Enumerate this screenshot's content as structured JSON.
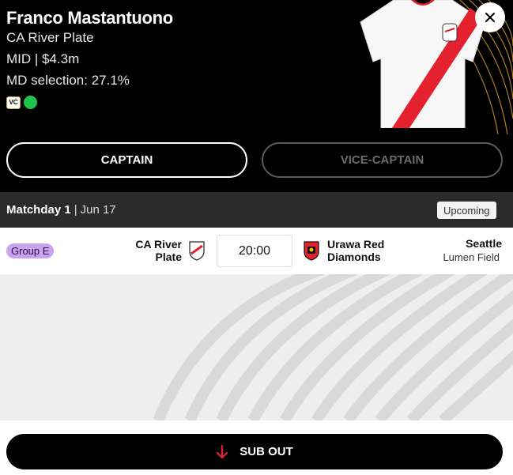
{
  "player": {
    "name": "Franco Mastantuono",
    "club": "CA River Plate",
    "position_price": "MID | $4.3m",
    "selection": "MD selection: 27.1%",
    "vc_badge": "VC"
  },
  "actions": {
    "captain_label": "CAPTAIN",
    "vice_captain_label": "VICE-CAPTAIN",
    "sub_out_label": "SUB OUT"
  },
  "matchday": {
    "title": "Matchday 1",
    "separator": "|",
    "date": "Jun 17",
    "status": "Upcoming"
  },
  "fixture": {
    "group": "Group E",
    "home_team": "CA River Plate",
    "away_team": "Urawa Red Diamonds",
    "kickoff": "20:00",
    "city": "Seattle",
    "stadium": "Lumen Field"
  },
  "colors": {
    "status_dot": "#1fc34a",
    "river_red": "#e4212e",
    "group_pill": "#c9a2f0",
    "sub_out_arrow": "#e4212e"
  }
}
